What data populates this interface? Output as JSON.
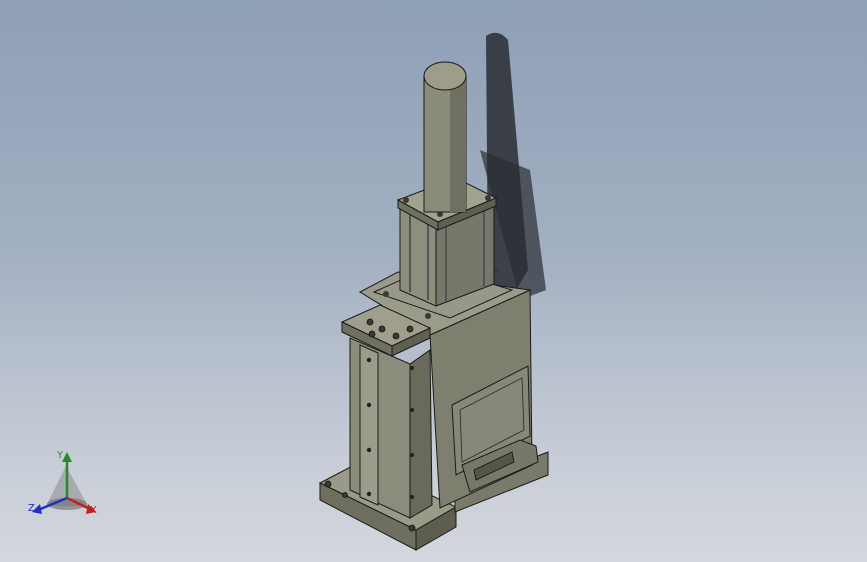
{
  "viewport": {
    "background_top": "#8e9fb6",
    "background_bottom": "#d3d7de"
  },
  "model": {
    "body_color": "#8a8a7a",
    "edge_color": "#1a1a1a"
  },
  "triad": {
    "x_label": "X",
    "y_label": "Y",
    "z_label": "Z",
    "x_color": "#c02020",
    "y_color": "#2a8a2a",
    "z_color": "#2030c0"
  }
}
